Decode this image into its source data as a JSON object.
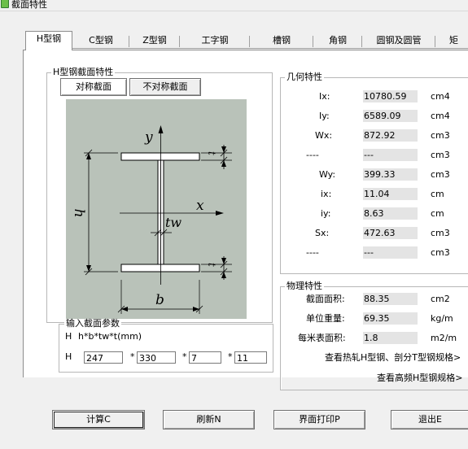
{
  "window": {
    "title": "截面特性"
  },
  "tabs": [
    "H型钢",
    "C型钢",
    "Z型钢",
    "工字钢",
    "槽钢",
    "角钢",
    "圆钢及圆管",
    "矩"
  ],
  "hsection": {
    "group_title": "H型钢截面特性",
    "sym_button": "对称截面",
    "asym_button": "不对称截面",
    "diagram_labels": {
      "y": "y",
      "x": "x",
      "h": "h",
      "tw": "tw",
      "b": "b",
      "t_top": "t",
      "t_bottom": "t"
    }
  },
  "input": {
    "group_title": "输入截面参数",
    "formula_letter": "H",
    "formula": "h*b*tw*t(mm)",
    "row_letter": "H",
    "ops": [
      "*",
      "*",
      "*"
    ],
    "values": [
      "247",
      "330",
      "7",
      "11"
    ]
  },
  "geometry": {
    "group_title": "几何特性",
    "rows": [
      {
        "label": "Ix:",
        "value": "10780.59",
        "unit": "cm4"
      },
      {
        "label": "Iy:",
        "value": "6589.09",
        "unit": "cm4"
      },
      {
        "label": "Wx:",
        "value": "872.92",
        "unit": "cm3"
      },
      {
        "label": "----",
        "value": "---",
        "unit": "cm3"
      },
      {
        "label": "Wy:",
        "value": "399.33",
        "unit": "cm3"
      },
      {
        "label": "ix:",
        "value": "11.04",
        "unit": "cm"
      },
      {
        "label": "iy:",
        "value": "8.63",
        "unit": "cm"
      },
      {
        "label": "Sx:",
        "value": "472.63",
        "unit": "cm3"
      },
      {
        "label": "----",
        "value": "---",
        "unit": "cm3"
      }
    ]
  },
  "physical": {
    "group_title": "物理特性",
    "rows": [
      {
        "label": "截面面积:",
        "value": "88.35",
        "unit": "cm2"
      },
      {
        "label": "单位重量:",
        "value": "69.35",
        "unit": "kg/m"
      },
      {
        "label": "每米表面积:",
        "value": "1.8",
        "unit": "m2/m"
      }
    ],
    "link1": "查看热轧H型钢、剖分T型钢规格>",
    "link2": "查看高频H型钢规格>"
  },
  "buttons": {
    "calc": "计算C",
    "refresh": "刷新N",
    "print": "界面打印P",
    "exit": "退出E"
  },
  "colors": {
    "diagram_bg": "#b9c2b9",
    "field_bg": "#e4e4e4",
    "window_bg": "#f0f0f0"
  }
}
